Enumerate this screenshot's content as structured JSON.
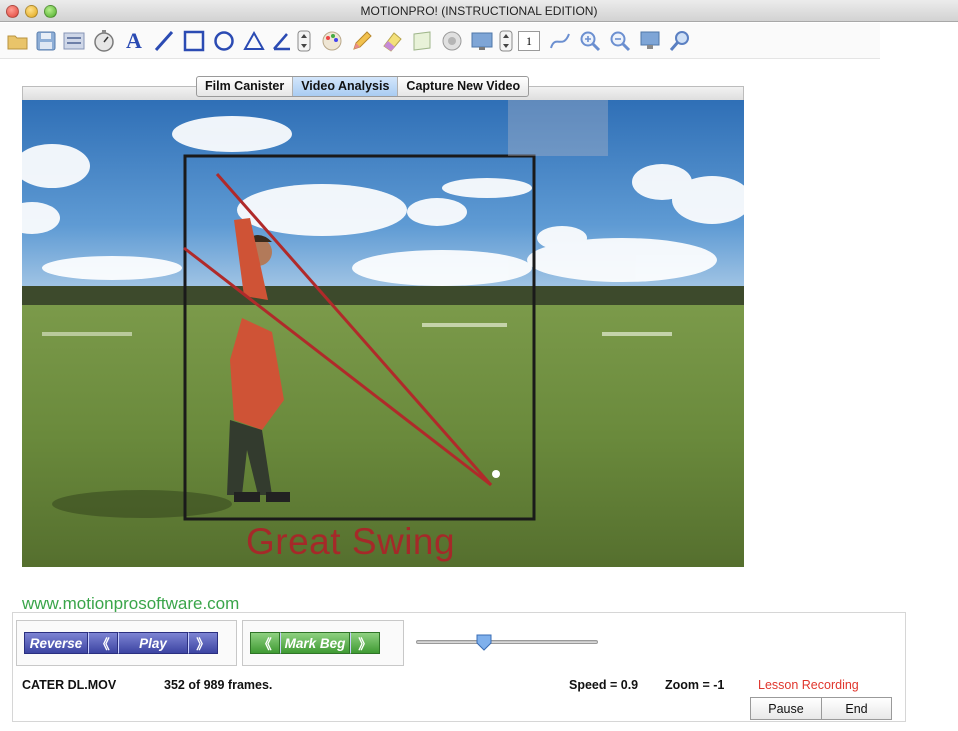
{
  "window": {
    "title": "MOTIONPRO! (INSTRUCTIONAL  EDITION)"
  },
  "toolbar": {
    "icons": [
      "folder-icon",
      "save-icon",
      "list-icon",
      "stopwatch-icon",
      "text-tool-icon",
      "line-tool-icon",
      "rectangle-tool-icon",
      "circle-tool-icon",
      "triangle-tool-icon",
      "angle-tool-icon",
      "stepper-icon",
      "color-palette-icon",
      "pencil-icon",
      "eraser-icon",
      "paper-icon",
      "settings-icon",
      "monitor-icon",
      "frame-stepper-icon",
      "curve-tool-icon",
      "zoom-in-icon",
      "zoom-out-icon",
      "display-icon",
      "magnifier-icon"
    ],
    "frame_step_value": "1",
    "text_tool_label": "A"
  },
  "tabs": [
    {
      "label": "Film Canister",
      "active": false
    },
    {
      "label": "Video Analysis",
      "active": true
    },
    {
      "label": "Capture New Video",
      "active": false
    }
  ],
  "video": {
    "overlay_caption": "Great Swing",
    "caption_color": "#a52929",
    "line_color": "#b02a2a",
    "box_color": "#1a1a1a"
  },
  "footer": {
    "website": "www.motionprosoftware.com",
    "playback": {
      "reverse_label": "Reverse",
      "step_back_label": "《",
      "play_label": "Play",
      "step_forward_label": "》"
    },
    "marking": {
      "mark_prev_label": "《",
      "mark_beg_label": "Mark Beg",
      "mark_next_label": "》"
    },
    "playback_position_fraction": 0.36,
    "file_name": "CATER DL.MOV",
    "frames_text": "352 of 989 frames.",
    "speed_text": "Speed = 0.9",
    "zoom_text": "Zoom =  -1",
    "lesson_recording_label": "Lesson Recording",
    "pause_label": "Pause",
    "end_label": "End"
  },
  "colors": {
    "website_green": "#3aa54a",
    "lesson_red": "#e0362d",
    "playback_blue": "#3c44a2",
    "mark_green": "#3f9a33",
    "active_tab": "#a9ccf2"
  }
}
